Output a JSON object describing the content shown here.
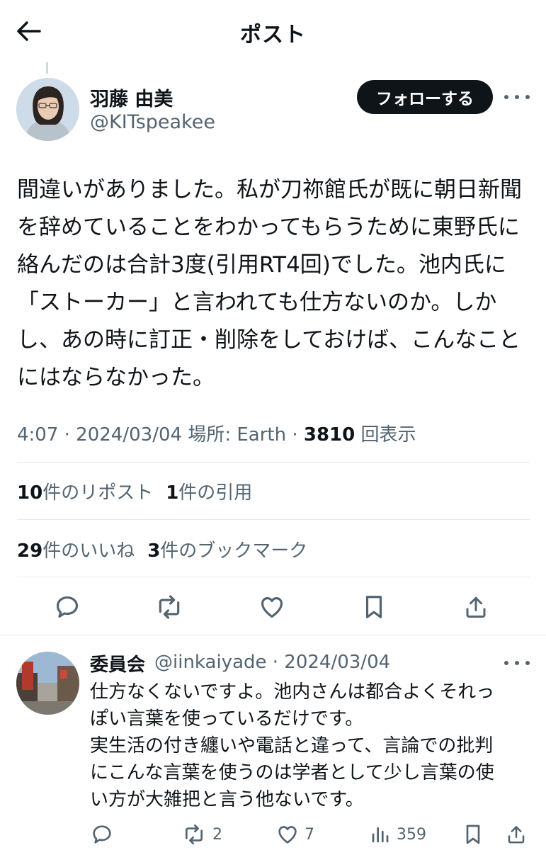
{
  "header": {
    "title": "ポスト"
  },
  "tweet": {
    "author_name": "羽藤 由美",
    "author_handle": "@KITspeakee",
    "follow_label": "フォローする",
    "text": "間違いがありました。私が刀祢館氏が既に朝日新聞\nを辞めていることをわかってもらうために東野氏に\n絡んだのは合計3度(引用RT4回)でした。池内氏に\n「ストーカー」と言われても仕方ないのか。しか\nし、あの時に訂正・削除をしておけば、こんなこと\nにはならなかった。",
    "meta": {
      "time_date": "4:07 · 2024/03/04",
      "location": "場所: Earth",
      "separator": "·",
      "views_count": "3810",
      "views_label": "回表示"
    },
    "stats": {
      "reposts_count": "10",
      "reposts_label": "件のリポスト",
      "quotes_count": "1",
      "quotes_label": "件の引用",
      "likes_count": "29",
      "likes_label": "件のいいね",
      "bookmarks_count": "3",
      "bookmarks_label": "件のブックマーク"
    },
    "actions": [
      "reply-icon",
      "repost-icon",
      "like-icon",
      "bookmark-icon",
      "share-icon"
    ]
  },
  "reply": {
    "author_name": "委員会",
    "author_handle_date": "@iinkaiyade · 2024/03/04",
    "text": "仕方なくないですよ。池内さんは都合よくそれっ\nぽい言葉を使っているだけです。\n実生活の付き纏いや電話と違って、言論での批判\nにこんな言葉を使うのは学者として少し言葉の使\nい方が大雑把と言う他ないです。",
    "actions": {
      "reposts": "2",
      "likes": "7",
      "views": "359"
    }
  },
  "colors": {
    "text": "#0f1419",
    "secondary": "#536471",
    "divider": "#e6e9ec",
    "follow_bg": "#0f1419"
  }
}
